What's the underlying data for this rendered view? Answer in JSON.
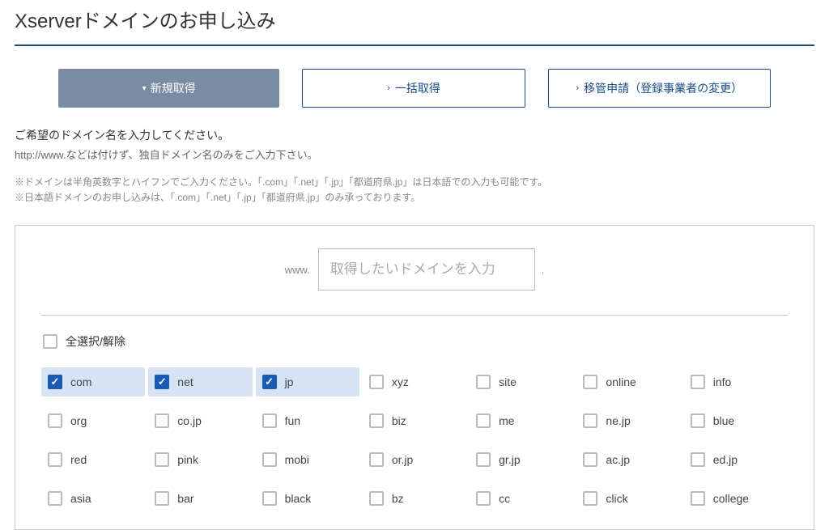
{
  "page_title": "Xserverドメインのお申し込み",
  "tabs": {
    "new": "新規取得",
    "bulk": "一括取得",
    "transfer": "移管申請（登録事業者の変更）"
  },
  "intro": {
    "line1": "ご希望のドメイン名を入力してください。",
    "line2": "http://www.などは付けず、独自ドメイン名のみをご入力下さい。"
  },
  "notes": {
    "n1": "※ドメインは半角英数字とハイフンでご入力ください。「.com」「.net」「.jp」「都道府県.jp」は日本語での入力も可能です。",
    "n2": "※日本語ドメインのお申し込みは、「.com」「.net」「.jp」「都道府県.jp」のみ承っております。"
  },
  "input": {
    "www": "www.",
    "placeholder": "取得したいドメインを入力",
    "dot": "."
  },
  "select_all": "全選択/解除",
  "tlds": [
    {
      "label": "com",
      "checked": true
    },
    {
      "label": "net",
      "checked": true
    },
    {
      "label": "jp",
      "checked": true
    },
    {
      "label": "xyz",
      "checked": false
    },
    {
      "label": "site",
      "checked": false
    },
    {
      "label": "online",
      "checked": false
    },
    {
      "label": "info",
      "checked": false
    },
    {
      "label": "org",
      "checked": false
    },
    {
      "label": "co.jp",
      "checked": false
    },
    {
      "label": "fun",
      "checked": false
    },
    {
      "label": "biz",
      "checked": false
    },
    {
      "label": "me",
      "checked": false
    },
    {
      "label": "ne.jp",
      "checked": false
    },
    {
      "label": "blue",
      "checked": false
    },
    {
      "label": "red",
      "checked": false
    },
    {
      "label": "pink",
      "checked": false
    },
    {
      "label": "mobi",
      "checked": false
    },
    {
      "label": "or.jp",
      "checked": false
    },
    {
      "label": "gr.jp",
      "checked": false
    },
    {
      "label": "ac.jp",
      "checked": false
    },
    {
      "label": "ed.jp",
      "checked": false
    },
    {
      "label": "asia",
      "checked": false
    },
    {
      "label": "bar",
      "checked": false
    },
    {
      "label": "black",
      "checked": false
    },
    {
      "label": "bz",
      "checked": false
    },
    {
      "label": "cc",
      "checked": false
    },
    {
      "label": "click",
      "checked": false
    },
    {
      "label": "college",
      "checked": false
    }
  ]
}
